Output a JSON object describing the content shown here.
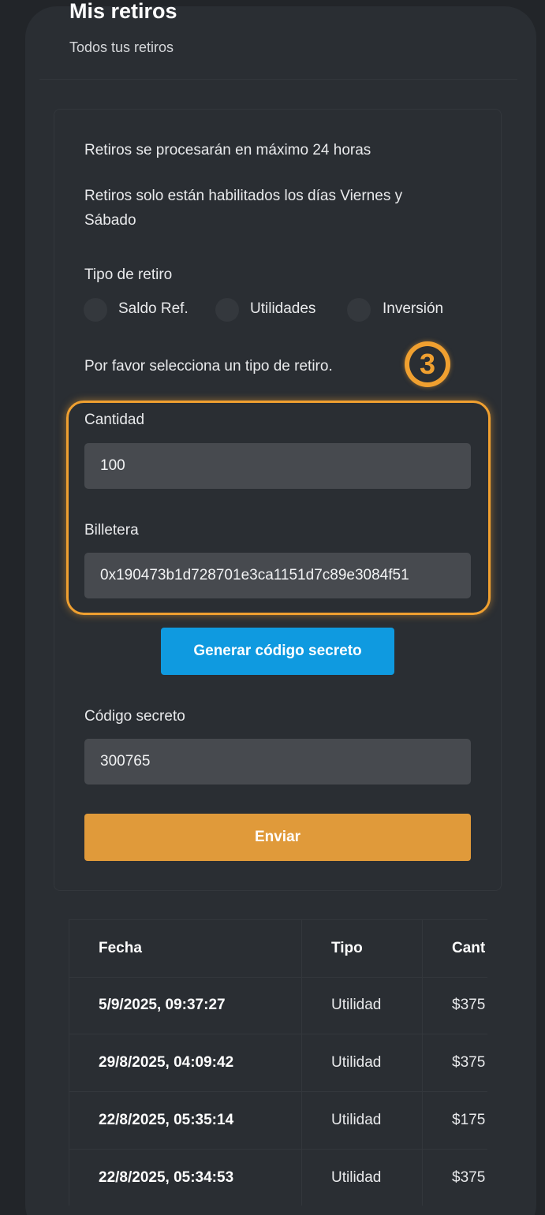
{
  "header": {
    "title": "Mis retiros",
    "subtitle": "Todos tus retiros"
  },
  "info": {
    "line1": "Retiros se procesarán en máximo 24 horas",
    "line2a": "Retiros solo están habilitados los días Viernes y",
    "line2b": "Sábado"
  },
  "withdraw_type": {
    "label": "Tipo de retiro",
    "options": [
      "Saldo Ref.",
      "Utilidades",
      "Inversión"
    ],
    "hint": "Por favor selecciona un tipo de retiro."
  },
  "step_number": "3",
  "amount": {
    "label": "Cantidad",
    "value": "100"
  },
  "wallet": {
    "label": "Billetera",
    "value": "0x190473b1d728701e3ca1151d7c89e3084f51"
  },
  "generate_button": "Generar código secreto",
  "secret_code": {
    "label": "Código secreto",
    "value": "300765"
  },
  "submit_button": "Enviar",
  "table": {
    "headers": [
      "Fecha",
      "Tipo",
      "Cant"
    ],
    "rows": [
      {
        "date": "5/9/2025, 09:37:27",
        "type": "Utilidad",
        "amount": "$375"
      },
      {
        "date": "29/8/2025, 04:09:42",
        "type": "Utilidad",
        "amount": "$375"
      },
      {
        "date": "22/8/2025, 05:35:14",
        "type": "Utilidad",
        "amount": "$175"
      },
      {
        "date": "22/8/2025, 05:34:53",
        "type": "Utilidad",
        "amount": "$375"
      }
    ]
  }
}
